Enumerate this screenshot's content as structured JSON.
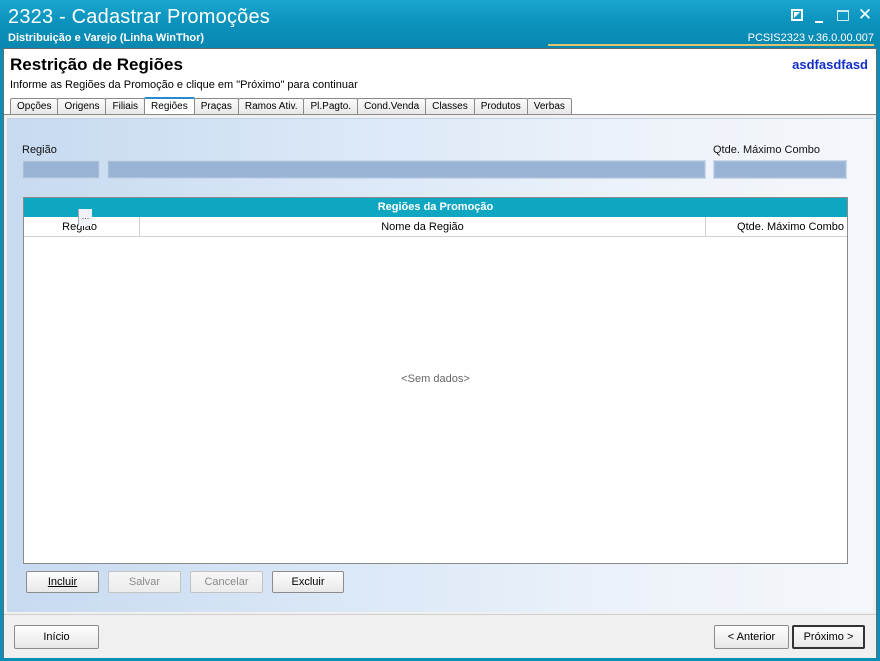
{
  "titlebar": {
    "title": "2323 - Cadastrar Promoções",
    "subtitle": "Distribuição e Varejo (Linha WinThor)",
    "version": "PCSIS2323  v.36.0.00.007"
  },
  "header": {
    "title": "Restrição de Regiões",
    "subtitle": "Informe as Regiões da Promoção e clique em \"Próximo\" para continuar",
    "user": "asdfasdfasd"
  },
  "tabs": [
    {
      "label": "Opções",
      "active": false
    },
    {
      "label": "Origens",
      "active": false
    },
    {
      "label": "Filiais",
      "active": false
    },
    {
      "label": "Regiões",
      "active": true
    },
    {
      "label": "Praças",
      "active": false
    },
    {
      "label": "Ramos Ativ.",
      "active": false
    },
    {
      "label": "Pl.Pagto.",
      "active": false
    },
    {
      "label": "Cond.Venda",
      "active": false
    },
    {
      "label": "Classes",
      "active": false
    },
    {
      "label": "Produtos",
      "active": false
    },
    {
      "label": "Verbas",
      "active": false
    }
  ],
  "form": {
    "regiao_label": "Região",
    "regiao_value": "",
    "lookup_button": "...",
    "nome_value": "",
    "qtde_label": "Qtde. Máximo Combo",
    "qtde_value": ""
  },
  "grid": {
    "caption": "Regiões da Promoção",
    "columns": [
      "Região",
      "Nome da Região",
      "Qtde. Máximo Combo"
    ],
    "rows": [],
    "empty_text": "<Sem dados>"
  },
  "actions": {
    "incluir": "Incluir",
    "salvar": "Salvar",
    "cancelar": "Cancelar",
    "excluir": "Excluir"
  },
  "footer": {
    "inicio": "Início",
    "anterior": "< Anterior",
    "proximo": "Próximo >"
  },
  "colors": {
    "titlebar": "#0b93bd",
    "grid_caption": "#0fa6c2",
    "user_text": "#1030c8"
  }
}
